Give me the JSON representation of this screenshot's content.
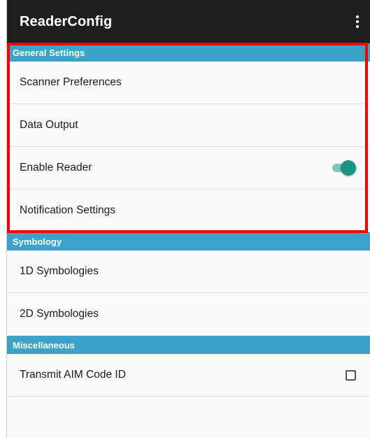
{
  "app_bar": {
    "title": "ReaderConfig",
    "menu_icon": "more-vert-icon"
  },
  "sections": [
    {
      "header": "General Settings",
      "items": [
        {
          "label": "Scanner Preferences",
          "control": "none"
        },
        {
          "label": "Data Output",
          "control": "none"
        },
        {
          "label": "Enable Reader",
          "control": "toggle",
          "checked": true
        },
        {
          "label": "Notification Settings",
          "control": "none"
        }
      ]
    },
    {
      "header": "Symbology",
      "items": [
        {
          "label": "1D Symbologies",
          "control": "none"
        },
        {
          "label": "2D Symbologies",
          "control": "none"
        }
      ]
    },
    {
      "header": "Miscellaneous",
      "items": [
        {
          "label": "Transmit AIM Code ID",
          "control": "checkbox",
          "checked": false
        }
      ]
    }
  ],
  "colors": {
    "app_bar_bg": "#1e1e1e",
    "section_header_bg": "#3aa3c7",
    "toggle_on": "#1a9484",
    "highlight": "#ff0000"
  }
}
